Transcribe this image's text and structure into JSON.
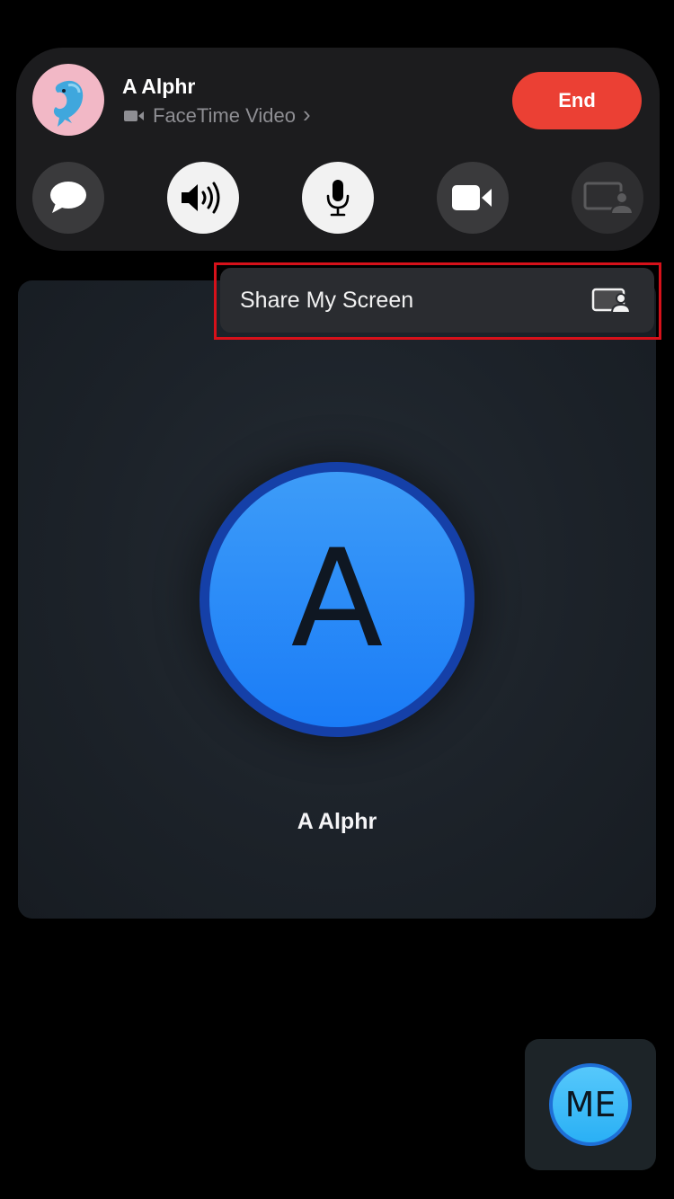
{
  "call": {
    "contact_name": "A Alphr",
    "call_type": "FaceTime Video",
    "chevron": "›",
    "end_label": "End",
    "colors": {
      "end_button": "#eb4034",
      "avatar_blue": "#1a7cf7",
      "highlight": "#d6111a"
    }
  },
  "controls": [
    {
      "name": "messages",
      "icon": "message-bubble-icon",
      "state": "off"
    },
    {
      "name": "speaker",
      "icon": "speaker-icon",
      "state": "on"
    },
    {
      "name": "microphone",
      "icon": "microphone-icon",
      "state": "on"
    },
    {
      "name": "camera",
      "icon": "video-camera-icon",
      "state": "off"
    },
    {
      "name": "share-play",
      "icon": "share-screen-icon",
      "state": "disabled"
    }
  ],
  "share_menu": {
    "label": "Share My Screen",
    "icon": "share-screen-icon"
  },
  "remote_tile": {
    "initial": "A",
    "name": "A Alphr"
  },
  "self_view": {
    "initials": "ME"
  }
}
